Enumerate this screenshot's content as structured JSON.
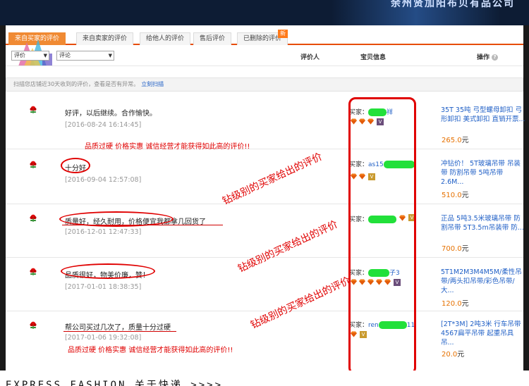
{
  "banner": {
    "text": "余州贤加阳布贝有品公司"
  },
  "tabs": [
    {
      "label": "来自买家的评价"
    },
    {
      "label": "来自卖家的评价"
    },
    {
      "label": "给他人的评价"
    },
    {
      "label": "售后评价"
    },
    {
      "label": "已删除的评价"
    }
  ],
  "tab_new_badge": "新",
  "filters": {
    "rating_select": "评价",
    "content_select": "评论"
  },
  "columns": {
    "reviewer": "评价人",
    "item_info": "宝贝信息",
    "actions": "操作"
  },
  "help_icon": "?",
  "notice": {
    "text": "扫描您店铺近30天收到的评价，查看是否有异常。",
    "link": "立刻扫描"
  },
  "buyer_label": "买家：",
  "reviews": [
    {
      "comment": "好评，以后继续。合作愉快。",
      "date": "[2016-08-24 16:14:45]",
      "buyer_suffix": "祥",
      "gem_count": 3,
      "badge": "V",
      "item_title": "35T 35吨 弓型螺母卸扣 弓形卸扣 美式卸扣 直销开票...",
      "price": "265.0",
      "unit": "元"
    },
    {
      "comment": "十分好",
      "date": "[2016-09-04 12:57:08]",
      "buyer_prefix": "as15",
      "gem_count": 2,
      "badge": "V",
      "item_title": "冲钻价！ 5T玻璃吊带 吊装带 防割吊带 5吨吊带2.6M...",
      "price": "510.0",
      "unit": "元"
    },
    {
      "comment": "质量好，经久耐用，价格便宜",
      "comment_extra": "我都拿几回货了",
      "date": "[2016-12-01 12:47:33]",
      "gem_count": 1,
      "badge": "V",
      "item_title": "正品 5吨3.5米玻璃吊带 防割吊带 5T3.5m吊装带 防...",
      "price": "700.0",
      "unit": "元"
    },
    {
      "comment": "品质很好，物美价廉，赞！",
      "date": "[2017-01-01 18:38:35]",
      "buyer_suffix": "子3",
      "gem_count": 5,
      "badge": "V",
      "item_title": "5T1M2M3M4M5M/柔性吊带/两头扣吊带/彩色吊带/大...",
      "price": "120.0",
      "unit": "元"
    },
    {
      "comment": "帮公司买过几次了，质量十分过硬",
      "date": "[2017-01-06 19:32:08]",
      "buyer_prefix": "ren",
      "buyer_suffix": "11",
      "gem_count": 1,
      "badge": "V",
      "item_title": "[2T*3M] 2吨3米 行车吊带4567扁平吊带 起重吊具 吊...",
      "price": "20.0",
      "unit": "元"
    }
  ],
  "annotations": {
    "note": "品质过硬 价格实惠 诚信经营才能获得如此高的评价!!",
    "diagonal": "钻级别的买家给出的评价"
  },
  "footer": {
    "text": "EXPRESS FASHION 关于快递 >>>>"
  },
  "colors": {
    "accent": "#f08a33",
    "link": "#1f5fc6",
    "price": "#e67100",
    "annotation": "#e00000",
    "highlight": "#22e03a"
  }
}
